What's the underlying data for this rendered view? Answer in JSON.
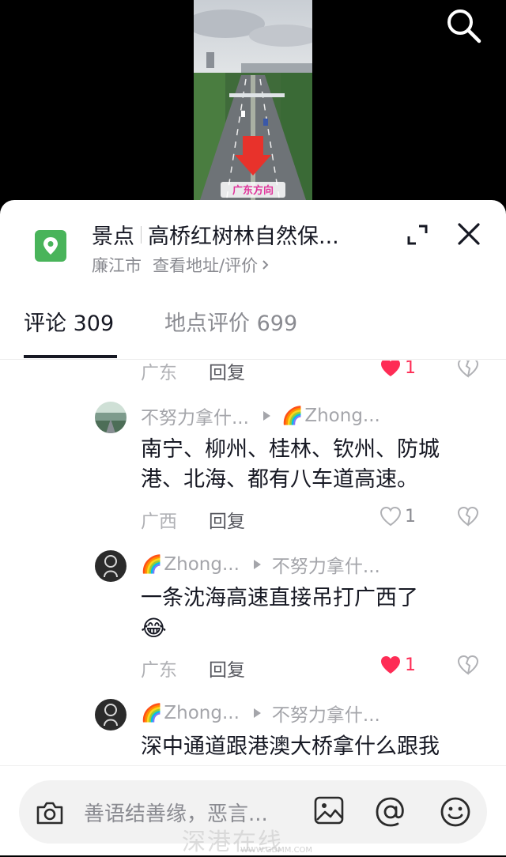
{
  "video": {
    "overlay_text": "广东方向"
  },
  "place": {
    "category": "景点",
    "name": "高桥红树林自然保...",
    "city": "廉江市",
    "address_link": "查看地址/评价",
    "accent_color": "#49b45a"
  },
  "tabs": [
    {
      "label": "评论 309",
      "active": true
    },
    {
      "label": "地点评价 699",
      "active": false
    }
  ],
  "comments": [
    {
      "partial": true,
      "region": "广东",
      "reply": "回复",
      "likes": "1",
      "liked": true
    },
    {
      "author": "不努力拿什...",
      "reply_to": "Zhong...",
      "text": "南宁、柳州、桂林、钦州、防城港、北海、都有八车道高速。",
      "region": "广西",
      "reply": "回复",
      "likes": "1",
      "liked": false
    },
    {
      "author": "Zhong...",
      "reply_to": "不努力拿什...",
      "text": "一条沈海高速直接吊打广西了",
      "emoji": "😂",
      "region": "广东",
      "reply": "回复",
      "likes": "1",
      "liked": true
    },
    {
      "author": "Zhong...",
      "reply_to": "不努力拿什...",
      "text": "深中通道跟港澳大桥拿什么跟我"
    }
  ],
  "input": {
    "placeholder": "善语结善缘，恶言..."
  },
  "watermark": {
    "text": "深港在线",
    "url": "WWW.GDMM.COM"
  },
  "colors": {
    "like_red": "#fe2c55",
    "text_primary": "#161823",
    "text_secondary": "#8a8b91"
  }
}
